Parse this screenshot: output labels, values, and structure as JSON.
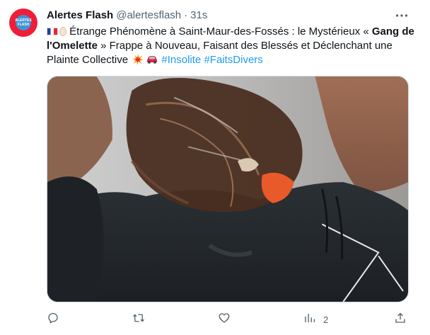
{
  "account": {
    "display_name": "Alertes Flash",
    "handle": "@alertesflash",
    "separator": "·",
    "time": "31s",
    "avatar_text_line1": "ALERTES",
    "avatar_text_line2": "FLASH"
  },
  "tweet": {
    "part1": " Étrange Phénomène à Saint-Maur-des-Fossés : le Mystérieux « ",
    "bold": "Gang de l'Omelette",
    "part2": " » Frappe à Nouveau, Faisant des Blessés et Déclenchant une Plainte Collective ",
    "hashtags": [
      "#Insolite",
      "#FaitsDivers"
    ],
    "emojis": [
      "flag-france-icon",
      "egg-icon",
      "collision-icon",
      "car-icon"
    ]
  },
  "media": {
    "alt": "photo"
  },
  "actions": {
    "reply_icon": "reply-icon",
    "retweet_icon": "retweet-icon",
    "like_icon": "like-icon",
    "views_icon": "analytics-icon",
    "views_count": "2",
    "share_icon": "share-icon"
  },
  "colors": {
    "link": "#1d9bf0",
    "secondary_text": "#536471",
    "primary_text": "#0f1419"
  }
}
